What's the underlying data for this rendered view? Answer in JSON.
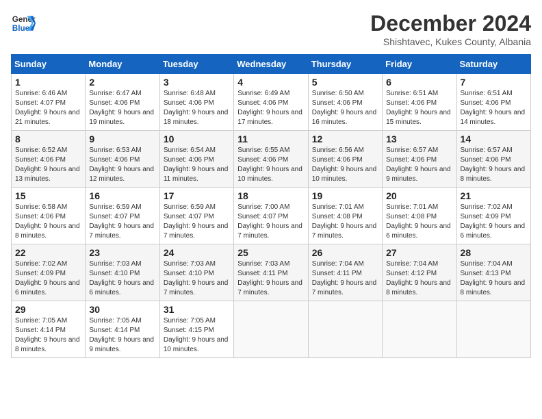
{
  "header": {
    "logo_line1": "General",
    "logo_line2": "Blue",
    "title": "December 2024",
    "subtitle": "Shishtavec, Kukes County, Albania"
  },
  "weekdays": [
    "Sunday",
    "Monday",
    "Tuesday",
    "Wednesday",
    "Thursday",
    "Friday",
    "Saturday"
  ],
  "weeks": [
    [
      {
        "day": "1",
        "sunrise": "6:46 AM",
        "sunset": "4:07 PM",
        "daylight": "9 hours and 21 minutes."
      },
      {
        "day": "2",
        "sunrise": "6:47 AM",
        "sunset": "4:06 PM",
        "daylight": "9 hours and 19 minutes."
      },
      {
        "day": "3",
        "sunrise": "6:48 AM",
        "sunset": "4:06 PM",
        "daylight": "9 hours and 18 minutes."
      },
      {
        "day": "4",
        "sunrise": "6:49 AM",
        "sunset": "4:06 PM",
        "daylight": "9 hours and 17 minutes."
      },
      {
        "day": "5",
        "sunrise": "6:50 AM",
        "sunset": "4:06 PM",
        "daylight": "9 hours and 16 minutes."
      },
      {
        "day": "6",
        "sunrise": "6:51 AM",
        "sunset": "4:06 PM",
        "daylight": "9 hours and 15 minutes."
      },
      {
        "day": "7",
        "sunrise": "6:51 AM",
        "sunset": "4:06 PM",
        "daylight": "9 hours and 14 minutes."
      }
    ],
    [
      {
        "day": "8",
        "sunrise": "6:52 AM",
        "sunset": "4:06 PM",
        "daylight": "9 hours and 13 minutes."
      },
      {
        "day": "9",
        "sunrise": "6:53 AM",
        "sunset": "4:06 PM",
        "daylight": "9 hours and 12 minutes."
      },
      {
        "day": "10",
        "sunrise": "6:54 AM",
        "sunset": "4:06 PM",
        "daylight": "9 hours and 11 minutes."
      },
      {
        "day": "11",
        "sunrise": "6:55 AM",
        "sunset": "4:06 PM",
        "daylight": "9 hours and 10 minutes."
      },
      {
        "day": "12",
        "sunrise": "6:56 AM",
        "sunset": "4:06 PM",
        "daylight": "9 hours and 10 minutes."
      },
      {
        "day": "13",
        "sunrise": "6:57 AM",
        "sunset": "4:06 PM",
        "daylight": "9 hours and 9 minutes."
      },
      {
        "day": "14",
        "sunrise": "6:57 AM",
        "sunset": "4:06 PM",
        "daylight": "9 hours and 8 minutes."
      }
    ],
    [
      {
        "day": "15",
        "sunrise": "6:58 AM",
        "sunset": "4:06 PM",
        "daylight": "9 hours and 8 minutes."
      },
      {
        "day": "16",
        "sunrise": "6:59 AM",
        "sunset": "4:07 PM",
        "daylight": "9 hours and 7 minutes."
      },
      {
        "day": "17",
        "sunrise": "6:59 AM",
        "sunset": "4:07 PM",
        "daylight": "9 hours and 7 minutes."
      },
      {
        "day": "18",
        "sunrise": "7:00 AM",
        "sunset": "4:07 PM",
        "daylight": "9 hours and 7 minutes."
      },
      {
        "day": "19",
        "sunrise": "7:01 AM",
        "sunset": "4:08 PM",
        "daylight": "9 hours and 7 minutes."
      },
      {
        "day": "20",
        "sunrise": "7:01 AM",
        "sunset": "4:08 PM",
        "daylight": "9 hours and 6 minutes."
      },
      {
        "day": "21",
        "sunrise": "7:02 AM",
        "sunset": "4:09 PM",
        "daylight": "9 hours and 6 minutes."
      }
    ],
    [
      {
        "day": "22",
        "sunrise": "7:02 AM",
        "sunset": "4:09 PM",
        "daylight": "9 hours and 6 minutes."
      },
      {
        "day": "23",
        "sunrise": "7:03 AM",
        "sunset": "4:10 PM",
        "daylight": "9 hours and 6 minutes."
      },
      {
        "day": "24",
        "sunrise": "7:03 AM",
        "sunset": "4:10 PM",
        "daylight": "9 hours and 7 minutes."
      },
      {
        "day": "25",
        "sunrise": "7:03 AM",
        "sunset": "4:11 PM",
        "daylight": "9 hours and 7 minutes."
      },
      {
        "day": "26",
        "sunrise": "7:04 AM",
        "sunset": "4:11 PM",
        "daylight": "9 hours and 7 minutes."
      },
      {
        "day": "27",
        "sunrise": "7:04 AM",
        "sunset": "4:12 PM",
        "daylight": "9 hours and 8 minutes."
      },
      {
        "day": "28",
        "sunrise": "7:04 AM",
        "sunset": "4:13 PM",
        "daylight": "9 hours and 8 minutes."
      }
    ],
    [
      {
        "day": "29",
        "sunrise": "7:05 AM",
        "sunset": "4:14 PM",
        "daylight": "9 hours and 8 minutes."
      },
      {
        "day": "30",
        "sunrise": "7:05 AM",
        "sunset": "4:14 PM",
        "daylight": "9 hours and 9 minutes."
      },
      {
        "day": "31",
        "sunrise": "7:05 AM",
        "sunset": "4:15 PM",
        "daylight": "9 hours and 10 minutes."
      },
      null,
      null,
      null,
      null
    ]
  ],
  "labels": {
    "sunrise": "Sunrise:",
    "sunset": "Sunset:",
    "daylight": "Daylight:"
  }
}
